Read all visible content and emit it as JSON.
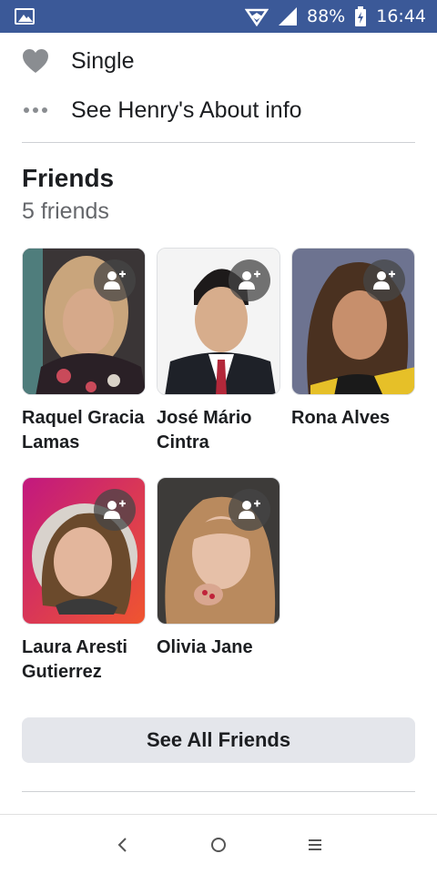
{
  "status_bar": {
    "battery": "88%",
    "time": "16:44"
  },
  "about": {
    "relationship": "Single",
    "see_about": "See Henry's About info"
  },
  "friends": {
    "title": "Friends",
    "count_label": "5 friends",
    "items": [
      {
        "name": "Raquel Gracia Lamas"
      },
      {
        "name": "José Mário Cintra"
      },
      {
        "name": "Rona Alves"
      },
      {
        "name": "Laura Aresti Gutierrez"
      },
      {
        "name": "Olivia Jane"
      }
    ],
    "see_all_label": "See All Friends"
  },
  "nav": {
    "back_icon": "back-icon",
    "home_icon": "home-icon",
    "recents_icon": "recents-icon"
  }
}
